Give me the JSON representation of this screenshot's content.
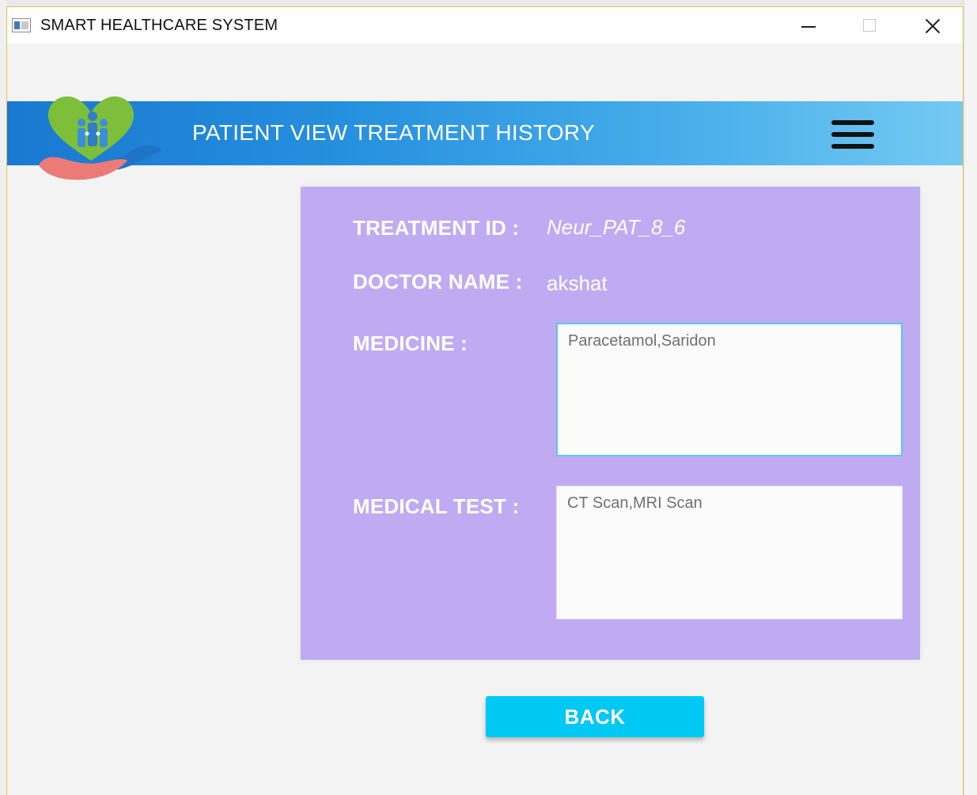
{
  "window": {
    "title": "SMART HEALTHCARE SYSTEM"
  },
  "header": {
    "heading": "PATIENT VIEW TREATMENT HISTORY",
    "menu_icon": "hamburger-menu-icon",
    "logo_icon": "heart-family-hand-logo"
  },
  "details": {
    "treatment_id_label": "TREATMENT ID :",
    "treatment_id_value": "Neur_PAT_8_6",
    "doctor_name_label": "DOCTOR NAME :",
    "doctor_name_value": "akshat",
    "medicine_label": "MEDICINE :",
    "medicine_value": "Paracetamol,Saridon",
    "medical_test_label": "MEDICAL TEST :",
    "medical_test_value": "CT Scan,MRI Scan"
  },
  "actions": {
    "back_label": "BACK"
  },
  "colors": {
    "header_gradient_start": "#1a78d0",
    "header_gradient_end": "#74c9f2",
    "panel": "#c0abf2",
    "back_button": "#00c8f5"
  }
}
